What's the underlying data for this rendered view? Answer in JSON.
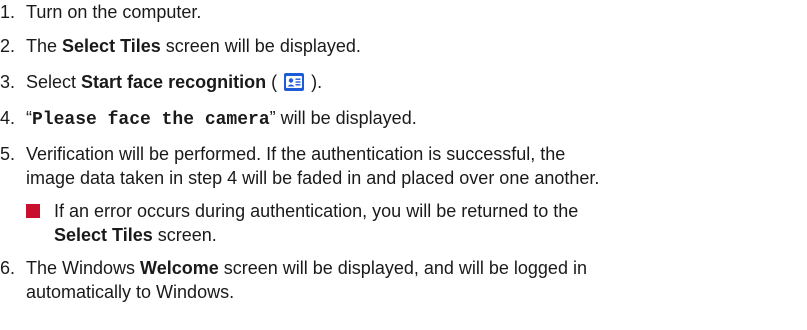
{
  "steps": [
    {
      "num": "1.",
      "text": "Turn on the computer."
    },
    {
      "num": "2.",
      "pre": "The ",
      "bold": "Select Tiles",
      "post": " screen will be displayed."
    },
    {
      "num": "3.",
      "pre": "Select ",
      "bold": "Start face recognition",
      "paren_open": " ( ",
      "icon": "face-recognition-id-card-icon",
      "paren_close": " )."
    },
    {
      "num": "4.",
      "quote_open": "“",
      "code": "Please face the camera",
      "quote_close": "” will be displayed."
    },
    {
      "num": "5.",
      "line1": "Verification will be performed. If the authentication is successful, the",
      "line2": "image data taken in step 4 will be faded in and placed over one another."
    },
    {
      "num": "6.",
      "line1_pre": "The Windows ",
      "line1_bold": "Welcome",
      "line1_post": " screen will be displayed, and will be logged in",
      "line2": "automatically to Windows."
    }
  ],
  "note": {
    "line1": "If an error occurs during authentication, you will be returned to the",
    "line2_bold": "Select Tiles",
    "line2_post": " screen."
  },
  "colors": {
    "bullet": "#c8102e",
    "icon_bg": "#1e5bd6"
  }
}
